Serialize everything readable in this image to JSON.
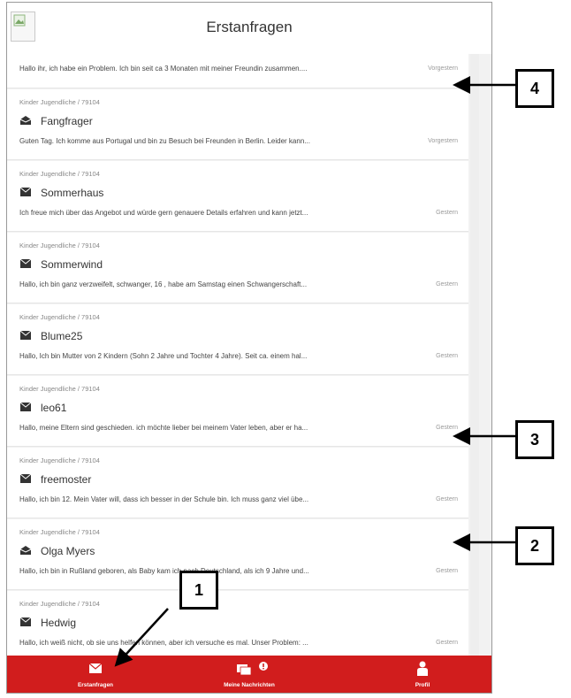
{
  "header": {
    "title": "Erstanfragen",
    "image_icon": "broken-image-icon"
  },
  "items": [
    {
      "category": "",
      "icon": "",
      "name": "",
      "preview": "Hallo ihr, ich habe ein Problem. Ich bin seit ca 3 Monaten mit meiner Freundin zusammen....",
      "time": "Vorgestern"
    },
    {
      "category": "Kinder Jugendliche / 79104",
      "icon": "envelope-open-icon",
      "name": "Fangfrager",
      "preview": "Guten Tag. Ich komme aus Portugal und bin zu Besuch bei Freunden in Berlin. Leider kann...",
      "time": "Vorgestern"
    },
    {
      "category": "Kinder Jugendliche / 79104",
      "icon": "envelope-icon",
      "name": "Sommerhaus",
      "preview": "Ich freue mich über das Angebot und würde gern genauere Details erfahren und kann jetzt...",
      "time": "Gestern"
    },
    {
      "category": "Kinder Jugendliche / 79104",
      "icon": "envelope-icon",
      "name": "Sommerwind",
      "preview": "Hallo, ich bin ganz verzweifelt, schwanger, 16 , habe am Samstag einen Schwangerschaft...",
      "time": "Gestern"
    },
    {
      "category": "Kinder Jugendliche / 79104",
      "icon": "envelope-icon",
      "name": "Blume25",
      "preview": "Hallo, Ich bin Mutter von 2 Kindern (Sohn 2 Jahre und Tochter 4 Jahre). Seit ca. einem hal...",
      "time": "Gestern"
    },
    {
      "category": "Kinder Jugendliche / 79104",
      "icon": "envelope-icon",
      "name": "leo61",
      "preview": "Hallo, meine Eltern sind geschieden. ich möchte lieber bei meinem Vater leben, aber er ha...",
      "time": "Gestern"
    },
    {
      "category": "Kinder Jugendliche / 79104",
      "icon": "envelope-icon",
      "name": "freemoster",
      "preview": "Hallo, ich bin 12. Mein Vater will, dass ich besser in der Schule bin. Ich muss ganz viel übe...",
      "time": "Gestern"
    },
    {
      "category": "Kinder Jugendliche / 79104",
      "icon": "envelope-open-icon",
      "name": "Olga Myers",
      "preview": "Hallo, ich bin in Rußland geboren, als Baby kam ich nach Deutschland, als ich 9 Jahre und...",
      "time": "Gestern"
    },
    {
      "category": "Kinder Jugendliche / 79104",
      "icon": "envelope-icon",
      "name": "Hedwig",
      "preview": "Hallo, ich weiß nicht, ob sie uns helfen können, aber ich versuche es mal. Unser Problem: ...",
      "time": "Gestern"
    }
  ],
  "tabbar": {
    "tabs": [
      {
        "label": "Erstanfragen",
        "icon": "envelope-icon"
      },
      {
        "label": "Meine Nachrichten",
        "icon": "chat-bubbles-icon"
      },
      {
        "label": "Profil",
        "icon": "person-icon"
      }
    ]
  },
  "callouts": [
    "1",
    "2",
    "3",
    "4"
  ],
  "colors": {
    "accent": "#d11d1d",
    "text": "#333333",
    "muted": "#888888"
  }
}
